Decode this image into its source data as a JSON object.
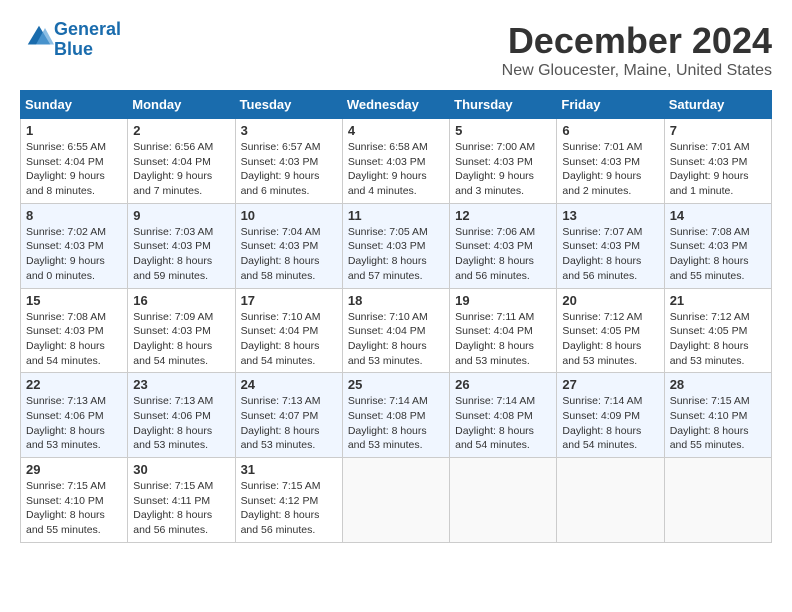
{
  "header": {
    "logo_line1": "General",
    "logo_line2": "Blue",
    "title": "December 2024",
    "location": "New Gloucester, Maine, United States"
  },
  "days_of_week": [
    "Sunday",
    "Monday",
    "Tuesday",
    "Wednesday",
    "Thursday",
    "Friday",
    "Saturday"
  ],
  "weeks": [
    [
      {
        "day": 1,
        "info": "Sunrise: 6:55 AM\nSunset: 4:04 PM\nDaylight: 9 hours\nand 8 minutes."
      },
      {
        "day": 2,
        "info": "Sunrise: 6:56 AM\nSunset: 4:04 PM\nDaylight: 9 hours\nand 7 minutes."
      },
      {
        "day": 3,
        "info": "Sunrise: 6:57 AM\nSunset: 4:03 PM\nDaylight: 9 hours\nand 6 minutes."
      },
      {
        "day": 4,
        "info": "Sunrise: 6:58 AM\nSunset: 4:03 PM\nDaylight: 9 hours\nand 4 minutes."
      },
      {
        "day": 5,
        "info": "Sunrise: 7:00 AM\nSunset: 4:03 PM\nDaylight: 9 hours\nand 3 minutes."
      },
      {
        "day": 6,
        "info": "Sunrise: 7:01 AM\nSunset: 4:03 PM\nDaylight: 9 hours\nand 2 minutes."
      },
      {
        "day": 7,
        "info": "Sunrise: 7:01 AM\nSunset: 4:03 PM\nDaylight: 9 hours\nand 1 minute."
      }
    ],
    [
      {
        "day": 8,
        "info": "Sunrise: 7:02 AM\nSunset: 4:03 PM\nDaylight: 9 hours\nand 0 minutes."
      },
      {
        "day": 9,
        "info": "Sunrise: 7:03 AM\nSunset: 4:03 PM\nDaylight: 8 hours\nand 59 minutes."
      },
      {
        "day": 10,
        "info": "Sunrise: 7:04 AM\nSunset: 4:03 PM\nDaylight: 8 hours\nand 58 minutes."
      },
      {
        "day": 11,
        "info": "Sunrise: 7:05 AM\nSunset: 4:03 PM\nDaylight: 8 hours\nand 57 minutes."
      },
      {
        "day": 12,
        "info": "Sunrise: 7:06 AM\nSunset: 4:03 PM\nDaylight: 8 hours\nand 56 minutes."
      },
      {
        "day": 13,
        "info": "Sunrise: 7:07 AM\nSunset: 4:03 PM\nDaylight: 8 hours\nand 56 minutes."
      },
      {
        "day": 14,
        "info": "Sunrise: 7:08 AM\nSunset: 4:03 PM\nDaylight: 8 hours\nand 55 minutes."
      }
    ],
    [
      {
        "day": 15,
        "info": "Sunrise: 7:08 AM\nSunset: 4:03 PM\nDaylight: 8 hours\nand 54 minutes."
      },
      {
        "day": 16,
        "info": "Sunrise: 7:09 AM\nSunset: 4:03 PM\nDaylight: 8 hours\nand 54 minutes."
      },
      {
        "day": 17,
        "info": "Sunrise: 7:10 AM\nSunset: 4:04 PM\nDaylight: 8 hours\nand 54 minutes."
      },
      {
        "day": 18,
        "info": "Sunrise: 7:10 AM\nSunset: 4:04 PM\nDaylight: 8 hours\nand 53 minutes."
      },
      {
        "day": 19,
        "info": "Sunrise: 7:11 AM\nSunset: 4:04 PM\nDaylight: 8 hours\nand 53 minutes."
      },
      {
        "day": 20,
        "info": "Sunrise: 7:12 AM\nSunset: 4:05 PM\nDaylight: 8 hours\nand 53 minutes."
      },
      {
        "day": 21,
        "info": "Sunrise: 7:12 AM\nSunset: 4:05 PM\nDaylight: 8 hours\nand 53 minutes."
      }
    ],
    [
      {
        "day": 22,
        "info": "Sunrise: 7:13 AM\nSunset: 4:06 PM\nDaylight: 8 hours\nand 53 minutes."
      },
      {
        "day": 23,
        "info": "Sunrise: 7:13 AM\nSunset: 4:06 PM\nDaylight: 8 hours\nand 53 minutes."
      },
      {
        "day": 24,
        "info": "Sunrise: 7:13 AM\nSunset: 4:07 PM\nDaylight: 8 hours\nand 53 minutes."
      },
      {
        "day": 25,
        "info": "Sunrise: 7:14 AM\nSunset: 4:08 PM\nDaylight: 8 hours\nand 53 minutes."
      },
      {
        "day": 26,
        "info": "Sunrise: 7:14 AM\nSunset: 4:08 PM\nDaylight: 8 hours\nand 54 minutes."
      },
      {
        "day": 27,
        "info": "Sunrise: 7:14 AM\nSunset: 4:09 PM\nDaylight: 8 hours\nand 54 minutes."
      },
      {
        "day": 28,
        "info": "Sunrise: 7:15 AM\nSunset: 4:10 PM\nDaylight: 8 hours\nand 55 minutes."
      }
    ],
    [
      {
        "day": 29,
        "info": "Sunrise: 7:15 AM\nSunset: 4:10 PM\nDaylight: 8 hours\nand 55 minutes."
      },
      {
        "day": 30,
        "info": "Sunrise: 7:15 AM\nSunset: 4:11 PM\nDaylight: 8 hours\nand 56 minutes."
      },
      {
        "day": 31,
        "info": "Sunrise: 7:15 AM\nSunset: 4:12 PM\nDaylight: 8 hours\nand 56 minutes."
      },
      null,
      null,
      null,
      null
    ]
  ]
}
